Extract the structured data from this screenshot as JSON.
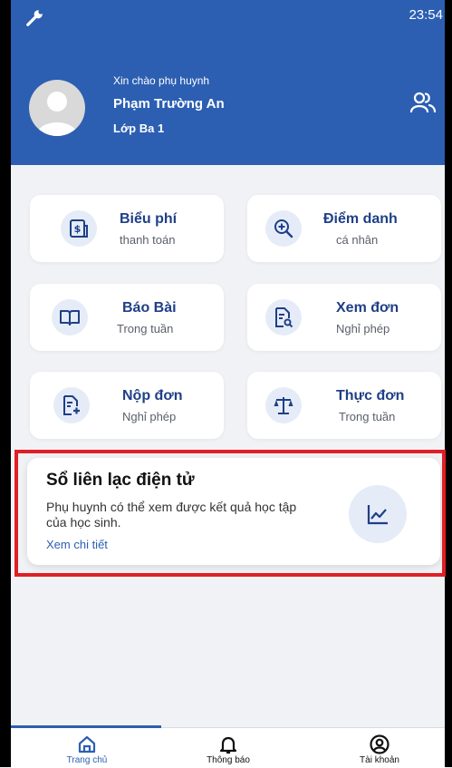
{
  "status_bar": {
    "time": "23:54",
    "left_icon": "wrench-icon"
  },
  "header": {
    "greeting": "Xin chào phụ huynh",
    "student_name": "Phạm Trường An",
    "class_name": "Lớp Ba 1",
    "avatar_icon": "avatar",
    "right_icon": "users-icon"
  },
  "tiles": [
    {
      "title": "Biểu phí",
      "subtitle": "thanh toán",
      "icon": "invoice-dollar-icon"
    },
    {
      "title": "Điểm danh",
      "subtitle": "cá nhân",
      "icon": "zoom-in-icon"
    },
    {
      "title": "Báo Bài",
      "subtitle": "Trong tuần",
      "icon": "open-book-icon"
    },
    {
      "title": "Xem đơn",
      "subtitle": "Nghỉ phép",
      "icon": "document-search-icon"
    },
    {
      "title": "Nộp đơn",
      "subtitle": "Nghỉ phép",
      "icon": "document-add-icon"
    },
    {
      "title": "Thực đơn",
      "subtitle": "Trong tuần",
      "icon": "scale-icon"
    }
  ],
  "contact_book": {
    "title": "Sổ liên lạc điện tử",
    "description": "Phụ huynh có thể xem được kết quả học tập của học sinh.",
    "link": "Xem chi tiết",
    "icon": "line-chart-icon"
  },
  "bottom_nav": [
    {
      "label": "Trang chủ",
      "icon": "home-icon",
      "active": true
    },
    {
      "label": "Thông báo",
      "icon": "bell-icon",
      "active": false
    },
    {
      "label": "Tài khoản",
      "icon": "account-icon",
      "active": false
    }
  ],
  "colors": {
    "primary": "#2c5fb2",
    "icon_bg": "#e5ecf8",
    "background": "#f1f2f5",
    "highlight": "#e01f26"
  }
}
